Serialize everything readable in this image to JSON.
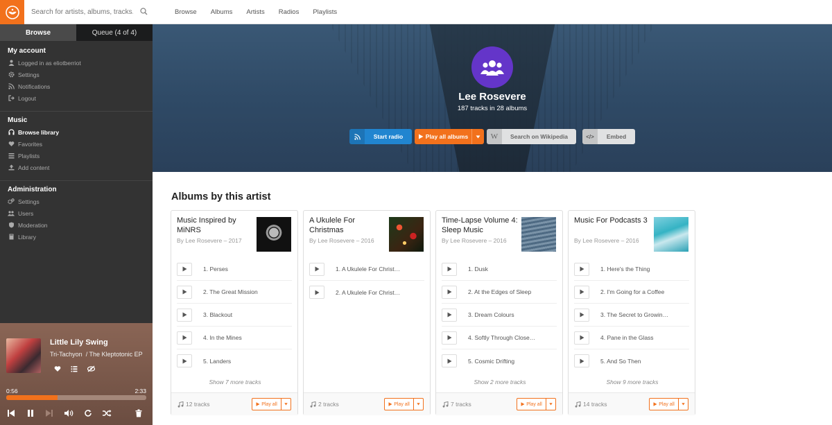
{
  "search": {
    "placeholder": "Search for artists, albums, tracks..."
  },
  "tabs": {
    "browse": "Browse",
    "queue": "Queue (4 of 4)"
  },
  "sidebar": {
    "account": {
      "title": "My account",
      "items": [
        "Logged in as eliotberriot",
        "Settings",
        "Notifications",
        "Logout"
      ]
    },
    "music": {
      "title": "Music",
      "items": [
        "Browse library",
        "Favorites",
        "Playlists",
        "Add content"
      ]
    },
    "admin": {
      "title": "Administration",
      "items": [
        "Settings",
        "Users",
        "Moderation",
        "Library"
      ]
    }
  },
  "player": {
    "title": "Little Lily Swing",
    "artist": "Tri-Tachyon",
    "album": "/ The Kleptotonic EP",
    "elapsed": "0:56",
    "duration": "2:33",
    "progress": 0.365
  },
  "topnav": [
    "Browse",
    "Albums",
    "Artists",
    "Radios",
    "Playlists"
  ],
  "hero": {
    "name": "Lee Rosevere",
    "stats": "187 tracks in 28 albums",
    "btn_radio": "Start radio",
    "btn_play": "Play all albums",
    "btn_wiki": "Search on Wikipedia",
    "btn_embed": "Embed",
    "wiki_glyph": "W",
    "embed_glyph": "</>"
  },
  "albums_title": "Albums by this artist",
  "albums": [
    {
      "title": "Music Inspired by MiNRS",
      "sub": "By Lee Rosevere – 2017",
      "tracks": [
        "1. Perses",
        "2. The Great Mission",
        "3. Blackout",
        "4. In the Mines",
        "5. Landers"
      ],
      "more": "Show 7 more tracks",
      "count": "12 tracks",
      "cover": "minrs"
    },
    {
      "title": "A Ukulele For Christmas",
      "sub": "By Lee Rosevere – 2016",
      "tracks": [
        "1. A Ukulele For Christ…",
        "2. A Ukulele For Christ…"
      ],
      "more": "",
      "count": "2 tracks",
      "cover": "ukulele"
    },
    {
      "title": "Time-Lapse Volume 4: Sleep Music",
      "sub": "By Lee Rosevere – 2016",
      "tracks": [
        "1. Dusk",
        "2. At the Edges of Sleep",
        "3. Dream Colours",
        "4. Softly Through Close…",
        "5. Cosmic Drifting"
      ],
      "more": "Show 2 more tracks",
      "count": "7 tracks",
      "cover": "timelapse"
    },
    {
      "title": "Music For Podcasts 3",
      "sub": "By Lee Rosevere – 2016",
      "tracks": [
        "1. Here's the Thing",
        "2. I'm Going for a Coffee",
        "3. The Secret to Growin…",
        "4. Pane in the Glass",
        "5. And So Then"
      ],
      "more": "Show 9 more tracks",
      "count": "14 tracks",
      "cover": "podcasts"
    }
  ],
  "playall_label": "Play all",
  "colors": {
    "accent": "#f2711c",
    "blue": "#2185d0",
    "violet": "#6435c9",
    "sidebar": "#333333"
  }
}
